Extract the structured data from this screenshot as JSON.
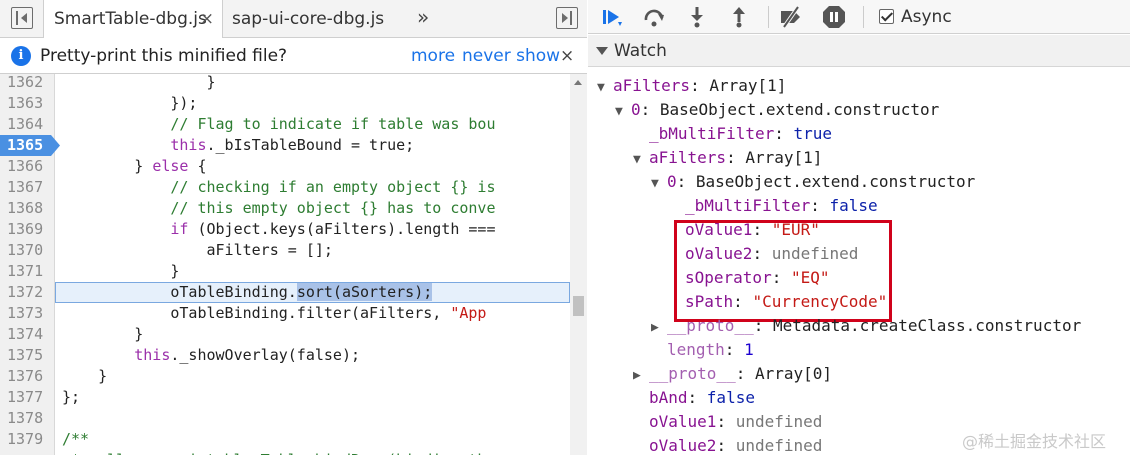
{
  "editor": {
    "tabs": [
      {
        "label": "SmartTable-dbg.js",
        "close": "×"
      },
      {
        "label": "sap-ui-core-dbg.js"
      }
    ],
    "overflow": "»",
    "notice": {
      "icon": "i",
      "text": "Pretty-print this minified file?",
      "more": "more",
      "never_show": "never show",
      "close": "×"
    },
    "breakpoint_line": 1365,
    "current_line": 1372,
    "lines": [
      {
        "n": "1362",
        "code": [
          {
            "t": "                }",
            "c": ""
          }
        ]
      },
      {
        "n": "1363",
        "code": [
          {
            "t": "            });",
            "c": ""
          }
        ]
      },
      {
        "n": "1364",
        "code": [
          {
            "t": "            // Flag to indicate if table was bou",
            "c": "cm"
          }
        ]
      },
      {
        "n": "1365",
        "code": [
          {
            "t": "            ",
            "c": ""
          },
          {
            "t": "this",
            "c": "kw"
          },
          {
            "t": "._bIsTableBound = true;",
            "c": ""
          }
        ]
      },
      {
        "n": "1366",
        "code": [
          {
            "t": "        } ",
            "c": ""
          },
          {
            "t": "else",
            "c": "kw"
          },
          {
            "t": " {",
            "c": ""
          }
        ]
      },
      {
        "n": "1367",
        "code": [
          {
            "t": "            // checking if an empty object {} is",
            "c": "cm"
          }
        ]
      },
      {
        "n": "1368",
        "code": [
          {
            "t": "            // this empty object {} has to conve",
            "c": "cm"
          }
        ]
      },
      {
        "n": "1369",
        "code": [
          {
            "t": "            ",
            "c": ""
          },
          {
            "t": "if",
            "c": "kw"
          },
          {
            "t": " (Object.keys(aFilters).length ===",
            "c": ""
          }
        ]
      },
      {
        "n": "1370",
        "code": [
          {
            "t": "                aFilters = [];",
            "c": ""
          }
        ]
      },
      {
        "n": "1371",
        "code": [
          {
            "t": "            }",
            "c": ""
          }
        ]
      },
      {
        "n": "1372",
        "code": [
          {
            "t": "            oTableBinding.",
            "c": ""
          },
          {
            "t": "sort(aSorters);",
            "c": "sel"
          }
        ]
      },
      {
        "n": "1373",
        "code": [
          {
            "t": "            oTableBinding.filter(aFilters, ",
            "c": ""
          },
          {
            "t": "\"App",
            "c": "str"
          }
        ]
      },
      {
        "n": "1374",
        "code": [
          {
            "t": "        }",
            "c": ""
          }
        ]
      },
      {
        "n": "1375",
        "code": [
          {
            "t": "        ",
            "c": ""
          },
          {
            "t": "this",
            "c": "kw"
          },
          {
            "t": "._showOverlay(false);",
            "c": ""
          }
        ]
      },
      {
        "n": "1376",
        "code": [
          {
            "t": "    }",
            "c": ""
          }
        ]
      },
      {
        "n": "1377",
        "code": [
          {
            "t": "};",
            "c": ""
          }
        ]
      },
      {
        "n": "1378",
        "code": [
          {
            "t": "",
            "c": ""
          }
        ]
      },
      {
        "n": "1379",
        "code": [
          {
            "t": "/**",
            "c": "cm"
          }
        ]
      },
      {
        "n": "",
        "code": [
          {
            "t": " * calls sap.ui.table.Table.bindRows(binding th",
            "c": "cm"
          }
        ]
      }
    ]
  },
  "debugger": {
    "async_label": "Async",
    "async_checked": true,
    "watch_title": "Watch",
    "tree": [
      {
        "indent": 0,
        "arrow": "▼",
        "key": "aFilters",
        "sep": ": ",
        "value": "Array[1]",
        "vt": "val-obj"
      },
      {
        "indent": 1,
        "arrow": "▼",
        "key": "0",
        "sep": ": ",
        "value": "BaseObject.extend.constructor",
        "vt": "val-obj"
      },
      {
        "indent": 2,
        "arrow": "",
        "key": "_bMultiFilter",
        "sep": ": ",
        "value": "true",
        "vt": "val-bool"
      },
      {
        "indent": 2,
        "arrow": "▼",
        "key": "aFilters",
        "sep": ": ",
        "value": "Array[1]",
        "vt": "val-obj"
      },
      {
        "indent": 3,
        "arrow": "▼",
        "key": "0",
        "sep": ": ",
        "value": "BaseObject.extend.constructor",
        "vt": "val-obj"
      },
      {
        "indent": 4,
        "arrow": "",
        "key": "_bMultiFilter",
        "sep": ": ",
        "value": "false",
        "vt": "val-bool"
      },
      {
        "indent": 4,
        "arrow": "",
        "key": "oValue1",
        "sep": ": ",
        "value": "\"EUR\"",
        "vt": "val-str"
      },
      {
        "indent": 4,
        "arrow": "",
        "key": "oValue2",
        "sep": ": ",
        "value": "undefined",
        "vt": "val-undef"
      },
      {
        "indent": 4,
        "arrow": "",
        "key": "sOperator",
        "sep": ": ",
        "value": "\"EQ\"",
        "vt": "val-str"
      },
      {
        "indent": 4,
        "arrow": "",
        "key": "sPath",
        "sep": ": ",
        "value": "\"CurrencyCode\"",
        "vt": "val-str"
      },
      {
        "indent": 3,
        "arrow": "▶",
        "key": "__proto__",
        "sep": ": ",
        "value": "Metadata.createClass.constructor",
        "vt": "val-obj",
        "dim": true
      },
      {
        "indent": 3,
        "arrow": "",
        "key": "length",
        "sep": ": ",
        "value": "1",
        "vt": "val-num",
        "dim": true
      },
      {
        "indent": 2,
        "arrow": "▶",
        "key": "__proto__",
        "sep": ": ",
        "value": "Array[0]",
        "vt": "val-obj",
        "dim": true
      },
      {
        "indent": 2,
        "arrow": "",
        "key": "bAnd",
        "sep": ": ",
        "value": "false",
        "vt": "val-bool"
      },
      {
        "indent": 2,
        "arrow": "",
        "key": "oValue1",
        "sep": ": ",
        "value": "undefined",
        "vt": "val-undef"
      },
      {
        "indent": 2,
        "arrow": "",
        "key": "oValue2",
        "sep": ": ",
        "value": "undefined",
        "vt": "val-undef"
      }
    ]
  },
  "watermark": "@稀土掘金技术社区",
  "colors": {
    "accent": "#1a73e8",
    "breakpoint": "#4a90e2",
    "highlight_box": "#d0021b"
  }
}
